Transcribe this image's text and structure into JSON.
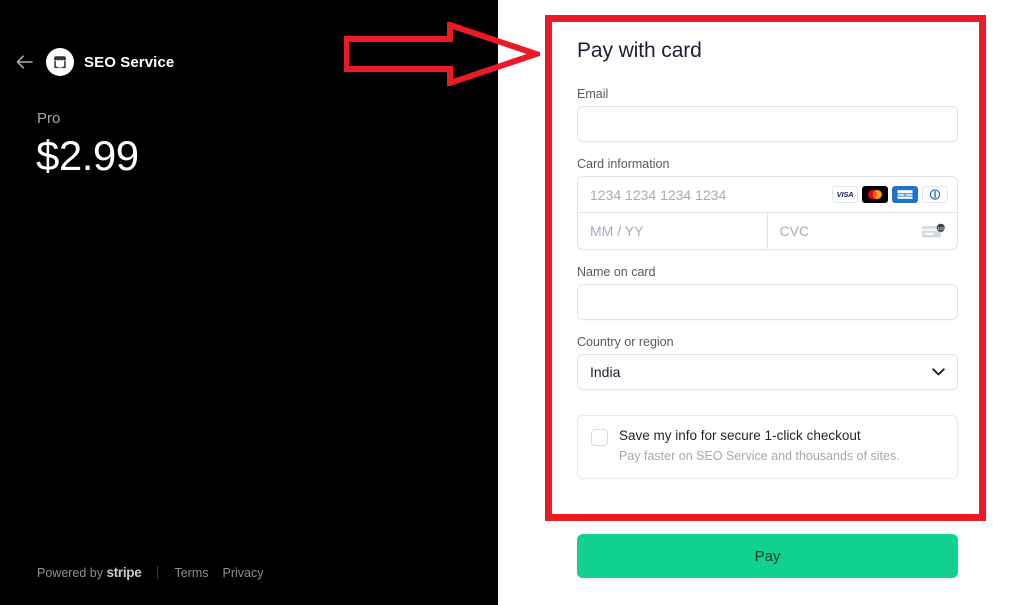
{
  "left": {
    "back_icon": "back-arrow-icon",
    "logo_icon": "storefront-icon",
    "merchant_name": "SEO Service",
    "plan_name": "Pro",
    "price": "$2.99",
    "footer": {
      "powered_by": "Powered by",
      "stripe": "stripe",
      "terms": "Terms",
      "privacy": "Privacy"
    }
  },
  "form": {
    "title": "Pay with card",
    "email": {
      "label": "Email",
      "value": "",
      "placeholder": ""
    },
    "card_information": {
      "label": "Card information",
      "number_placeholder": "1234 1234 1234 1234",
      "number_value": "",
      "expiry_placeholder": "MM / YY",
      "expiry_value": "",
      "cvc_placeholder": "CVC",
      "cvc_value": "",
      "brands": [
        {
          "name": "visa-icon",
          "label": "VISA"
        },
        {
          "name": "mastercard-icon",
          "label": ""
        },
        {
          "name": "amex-icon",
          "label": ""
        },
        {
          "name": "discover-icon",
          "label": ""
        }
      ],
      "cvc_hint_icon": "cvc-card-hint-icon"
    },
    "name_on_card": {
      "label": "Name on card",
      "value": "",
      "placeholder": ""
    },
    "country": {
      "label": "Country or region",
      "selected": "India",
      "chevron_icon": "chevron-down-icon"
    },
    "save_info": {
      "checked": false,
      "title": "Save my info for secure 1-click checkout",
      "subtitle": "Pay faster on SEO Service and thousands of sites."
    },
    "pay_button": "Pay"
  },
  "annotations": {
    "highlight_color": "#ea1b24",
    "arrow_icon": "annotation-arrow-right",
    "rect_icon": "annotation-rectangle"
  },
  "colors": {
    "panel_background": "#000000",
    "page_background": "#ffffff",
    "pay_button": "#11d18e",
    "annotation_red": "#ea1b24",
    "label_gray": "#555a62",
    "placeholder_gray": "#a6acb7"
  }
}
